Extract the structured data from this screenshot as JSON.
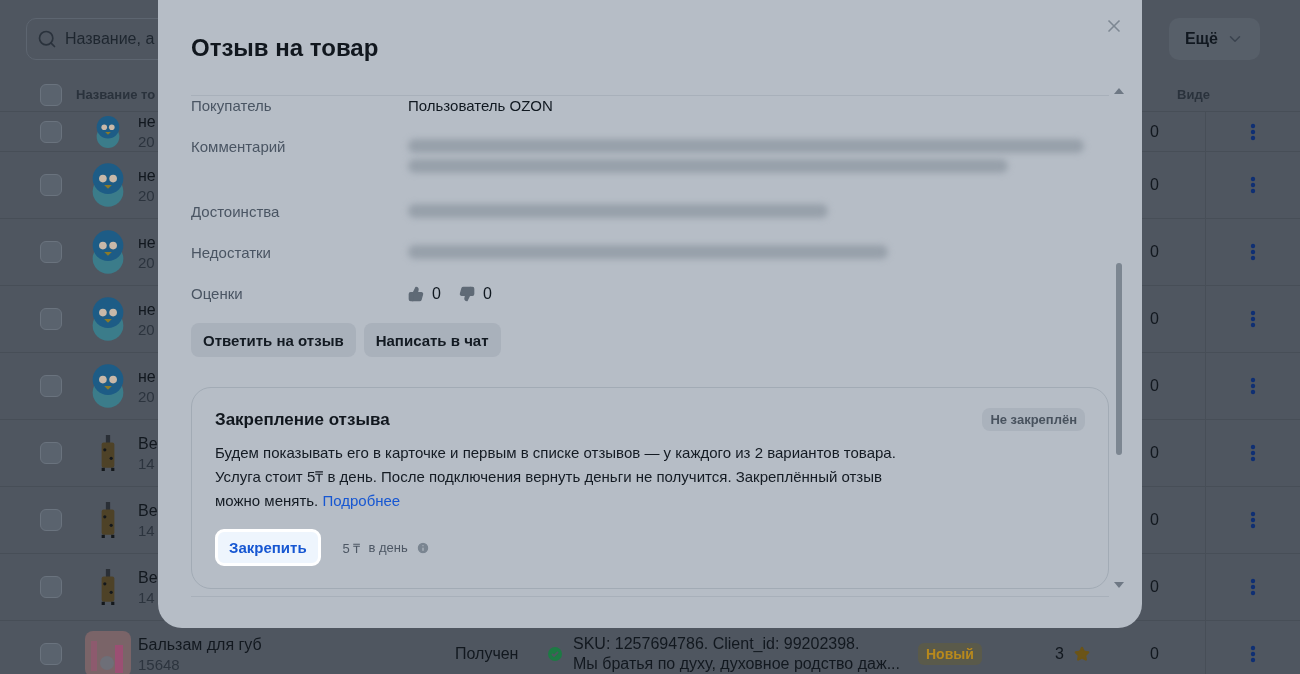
{
  "search": {
    "placeholder": "Название, а"
  },
  "more_button": {
    "label": "Ещё"
  },
  "table": {
    "select_all": {
      "checked": false
    },
    "columns": [
      {
        "label": "Название то"
      },
      {
        "label": "Виде"
      }
    ],
    "rows": [
      {
        "kind": "penguin",
        "checked": false,
        "name": "не",
        "code": "20",
        "count": "0"
      },
      {
        "kind": "penguin",
        "checked": false,
        "name": "не",
        "code": "20",
        "count": "0"
      },
      {
        "kind": "penguin",
        "checked": false,
        "name": "не",
        "code": "20",
        "count": "0"
      },
      {
        "kind": "penguin",
        "checked": false,
        "name": "не",
        "code": "20",
        "count": "0"
      },
      {
        "kind": "penguin",
        "checked": false,
        "name": "не",
        "code": "20",
        "count": "0"
      },
      {
        "kind": "suitcase",
        "checked": false,
        "name": "Ве",
        "code": "14",
        "count": "0"
      },
      {
        "kind": "suitcase",
        "checked": false,
        "name": "Ве",
        "code": "14",
        "count": "0"
      },
      {
        "kind": "suitcase",
        "checked": false,
        "name": "Ве",
        "code": "14",
        "count": "0"
      },
      {
        "kind": "balm",
        "checked": false,
        "name": "Бальзам для губ",
        "code": "15648",
        "status": "Получен",
        "sku": "SKU: 1257694786. Client_id: 99202398.",
        "comment": "Мы братья по духу, духовное родство даж...",
        "badge": "Новый",
        "rating": "3",
        "count": "0"
      }
    ]
  },
  "dialog": {
    "title": "Отзыв на товар",
    "fields": [
      {
        "kind": "text",
        "label": "Покупатель",
        "value": "Пользователь OZON"
      },
      {
        "kind": "blurred",
        "label": "Комментарий"
      },
      {
        "kind": "blurred",
        "label": "Достоинства"
      },
      {
        "kind": "blurred",
        "label": "Недостатки"
      },
      {
        "kind": "votes",
        "label": "Оценки",
        "likes": "0",
        "dislikes": "0"
      }
    ],
    "buttons": [
      "Ответить на отзыв",
      "Написать в чат"
    ],
    "pin": {
      "title": "Закрепление отзыва",
      "status": "Не закреплён",
      "text": "Будем показывать его в карточке и первым в списке отзывов — у каждого из 2 вариантов товара. Услуга стоит 5₸ в день. После подключения вернуть деньги не получится. Закреплённый отзыв можно менять.",
      "link": "Подробнее",
      "button": "Закрепить",
      "price": "5 ₸",
      "period": "в день"
    }
  }
}
